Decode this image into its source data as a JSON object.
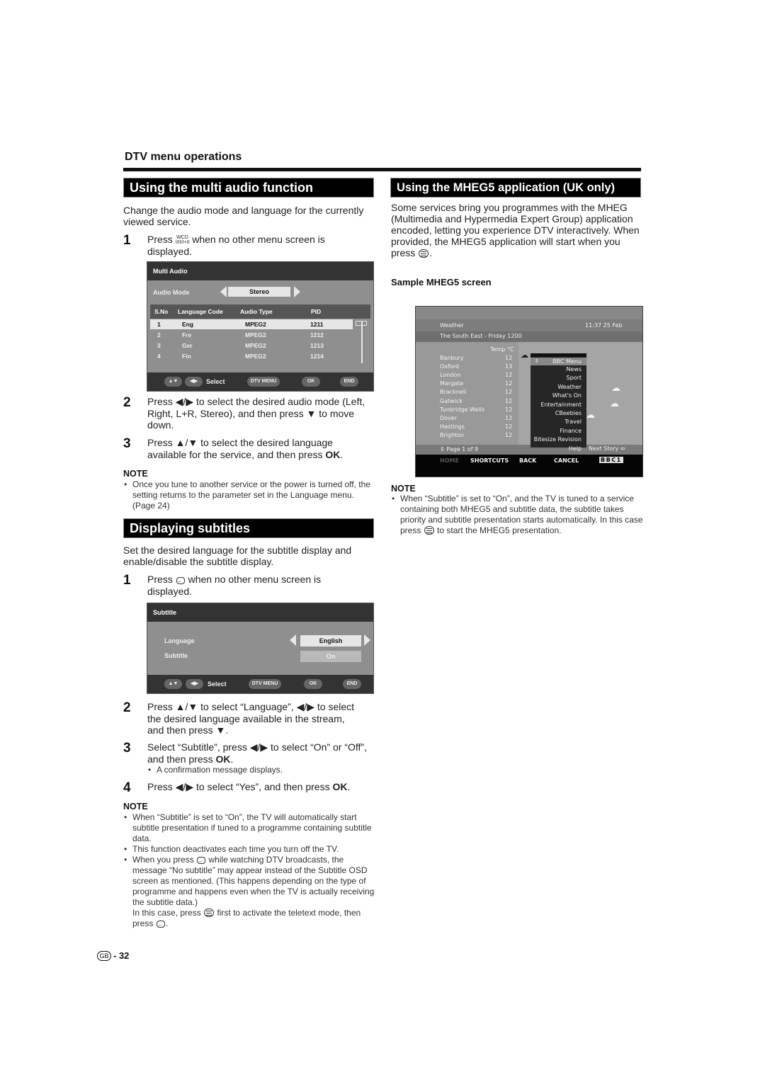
{
  "header": {
    "section_title": "DTV menu operations"
  },
  "left": {
    "multi_audio": {
      "title": "Using the multi audio function",
      "intro": "Change the audio mode and language for the currently viewed service.",
      "steps": [
        {
          "num": "1",
          "pre": "Press",
          "icon": "audio-mode-button",
          "icon_text": "WCD\nI/II/I+II",
          "post": "when no other menu screen is displayed."
        },
        {
          "num": "2",
          "text": "Press ◀/▶ to select the desired audio mode (Left, Right, L+R, Stereo), and then press ▼ to move down."
        },
        {
          "num": "3",
          "text_a": "Press ▲/▼ to select the desired language available for the service, and then press ",
          "bold": "OK",
          "text_b": "."
        }
      ],
      "osd": {
        "title": "Multi Audio",
        "mode_label": "Audio Mode",
        "mode_value": "Stereo",
        "columns": [
          "S.No",
          "Language Code",
          "Audio Type",
          "PID"
        ],
        "rows": [
          {
            "sno": "1",
            "lang": "Eng",
            "type": "MPEG2",
            "pid": "1211",
            "selected": true
          },
          {
            "sno": "2",
            "lang": "Fre",
            "type": "MPEG2",
            "pid": "1212",
            "selected": false
          },
          {
            "sno": "3",
            "lang": "Ger",
            "type": "MPEG2",
            "pid": "1213",
            "selected": false
          },
          {
            "sno": "4",
            "lang": "Fin",
            "type": "MPEG2",
            "pid": "1214",
            "selected": false
          }
        ],
        "footer": {
          "select": "Select",
          "dtv_menu": "DTV MENU",
          "ok": "OK",
          "end": "END"
        }
      },
      "note_heading": "NOTE",
      "notes": [
        "Once you tune to another service or the power is turned off, the setting returns to the parameter set in the Language menu. (Page 24)"
      ]
    },
    "subtitles": {
      "title": "Displaying subtitles",
      "intro": "Set the desired language for the subtitle display and enable/disable the subtitle display.",
      "step1": {
        "num": "1",
        "pre": "Press",
        "post": "when no other menu screen is displayed."
      },
      "osd": {
        "title": "Subtitle",
        "language_label": "Language",
        "language_value": "English",
        "subtitle_label": "Subtitle",
        "subtitle_value": "On",
        "footer": {
          "select": "Select",
          "dtv_menu": "DTV MENU",
          "ok": "OK",
          "end": "END"
        }
      },
      "step2": {
        "num": "2",
        "text": "Press ▲/▼ to select “Language”, ◀/▶ to select the desired language available in the stream, and then press ▼."
      },
      "step3": {
        "num": "3",
        "text_a": "Select “Subtitle”, press ◀/▶ to select “On” or “Off”, and then press ",
        "bold": "OK",
        "text_b": ".",
        "sub": "A confirmation message displays."
      },
      "step4": {
        "num": "4",
        "text_a": "Press ◀/▶ to select “Yes”, and then press ",
        "bold": "OK",
        "text_b": "."
      },
      "note_heading": "NOTE",
      "notes": {
        "n1": "When “Subtitle” is set to “On”, the TV will automatically start subtitle presentation if tuned to a programme containing subtitle data.",
        "n2": "This function deactivates each time you turn off the TV.",
        "n3_a": "When you press",
        "n3_b": "while watching DTV broadcasts, the message “No subtitle” may appear instead of the Subtitle OSD screen as mentioned. (This happens depending on the type of programme and happens even when the TV is actually receiving the subtitle data.)",
        "n3_c": "In this case, press",
        "n3_d": "first to activate the teletext mode, then press",
        "n3_e": "."
      }
    }
  },
  "right": {
    "mheg": {
      "title": "Using the MHEG5 application (UK only)",
      "intro_a": "Some services bring you programmes with the MHEG (Multimedia and Hypermedia Expert Group) application encoded, letting you experience DTV interactively. When provided, the MHEG5 application will start when you press",
      "intro_b": ".",
      "sample_label": "Sample MHEG5 screen",
      "screen": {
        "header_left": "Weather",
        "header_right": "11:37  25 Feb",
        "subheader": "The South East - Friday 1200",
        "temp_header": "Temp °C",
        "cities": [
          {
            "name": "Banbury",
            "temp": "12"
          },
          {
            "name": "Oxford",
            "temp": "13"
          },
          {
            "name": "London",
            "temp": "12"
          },
          {
            "name": "Margate",
            "temp": "12"
          },
          {
            "name": "Bracknell",
            "temp": "12"
          },
          {
            "name": "Gatwick",
            "temp": "12"
          },
          {
            "name": "Tunbridge Wells",
            "temp": "12"
          },
          {
            "name": "Dover",
            "temp": "12"
          },
          {
            "name": "Hastings",
            "temp": "12"
          },
          {
            "name": "Brighton",
            "temp": "12"
          }
        ],
        "menu_title": "BBC Menu",
        "menu_items": [
          "News",
          "Sport",
          "Weather",
          "What's On",
          "Entertainment",
          "CBeebies",
          "Travel",
          "Finance",
          "Bitesize Revision",
          "Help"
        ],
        "page_indicator": "Page 1 of 9",
        "next_story": "Next Story",
        "bottom_nav": [
          "HOME",
          "SHORTCUTS",
          "BACK",
          "CANCEL"
        ],
        "channel_logo": "BBC1"
      },
      "note_heading": "NOTE",
      "note_a": "When “Subtitle” is set to “On”, and the TV is tuned to a service containing both MHEG5 and subtitle data, the subtitle takes priority and subtitle presentation starts automatically. In this case press",
      "note_b": "to start the MHEG5 presentation."
    }
  },
  "footer": {
    "region_badge": "GB",
    "page_number": "- 32"
  }
}
